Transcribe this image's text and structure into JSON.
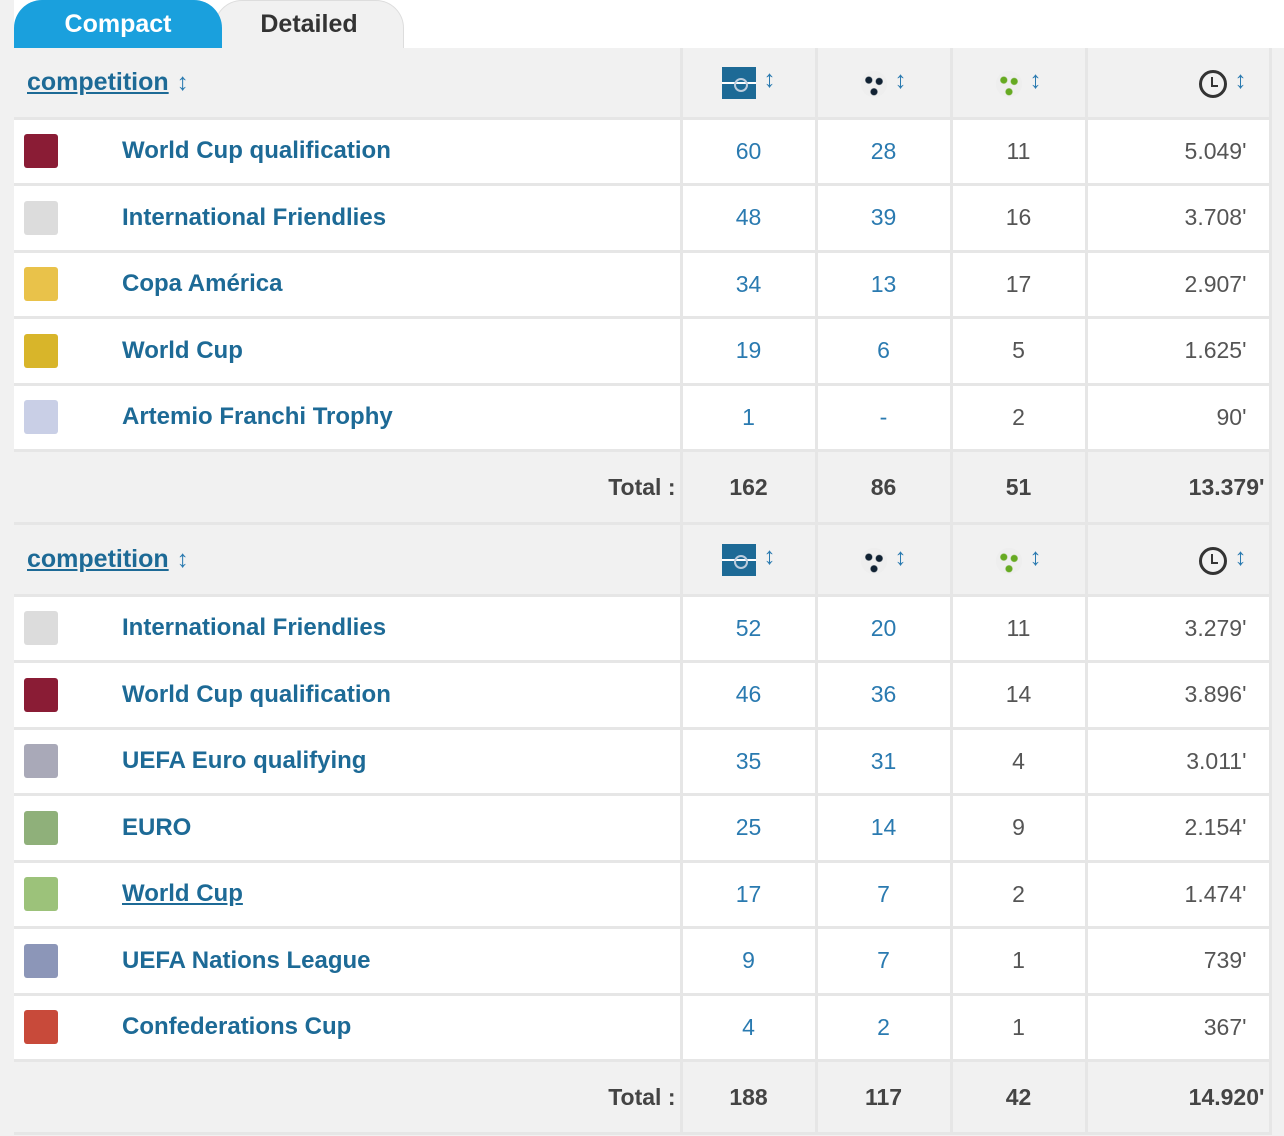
{
  "tabs": [
    {
      "label": "Compact",
      "active": true
    },
    {
      "label": "Detailed",
      "active": false
    }
  ],
  "header": {
    "competition": "competition",
    "sort_icon": "↕",
    "columns": [
      "appearances-icon",
      "goals-icon",
      "assists-icon",
      "minutes-icon"
    ]
  },
  "tables": [
    {
      "rows": [
        {
          "logo_color": "#8a1c35",
          "name": "World Cup qualification",
          "apps": "60",
          "goals": "28",
          "assists": "11",
          "minutes": "5.049'"
        },
        {
          "logo_color": "#dcdcdc",
          "name": "International Friendlies",
          "apps": "48",
          "goals": "39",
          "assists": "16",
          "minutes": "3.708'"
        },
        {
          "logo_color": "#e9c24a",
          "name": "Copa América",
          "apps": "34",
          "goals": "13",
          "assists": "17",
          "minutes": "2.907'"
        },
        {
          "logo_color": "#d8b52a",
          "name": "World Cup",
          "apps": "19",
          "goals": "6",
          "assists": "5",
          "minutes": "1.625'"
        },
        {
          "logo_color": "#c9cfe6",
          "name": "Artemio Franchi Trophy",
          "apps": "1",
          "goals": "-",
          "assists": "2",
          "minutes": "90'"
        }
      ],
      "total": {
        "label": "Total :",
        "apps": "162",
        "goals": "86",
        "assists": "51",
        "minutes": "13.379'"
      }
    },
    {
      "rows": [
        {
          "logo_color": "#dcdcdc",
          "name": "International Friendlies",
          "apps": "52",
          "goals": "20",
          "assists": "11",
          "minutes": "3.279'"
        },
        {
          "logo_color": "#8a1c35",
          "name": "World Cup qualification",
          "apps": "46",
          "goals": "36",
          "assists": "14",
          "minutes": "3.896'"
        },
        {
          "logo_color": "#a9a9b8",
          "name": "UEFA Euro qualifying",
          "apps": "35",
          "goals": "31",
          "assists": "4",
          "minutes": "3.011'"
        },
        {
          "logo_color": "#8fb07a",
          "name": "EURO",
          "apps": "25",
          "goals": "14",
          "assists": "9",
          "minutes": "2.154'"
        },
        {
          "logo_color": "#9cc27a",
          "name": "World Cup",
          "apps": "17",
          "goals": "7",
          "assists": "2",
          "minutes": "1.474'",
          "hover": true
        },
        {
          "logo_color": "#8c96b8",
          "name": "UEFA Nations League",
          "apps": "9",
          "goals": "7",
          "assists": "1",
          "minutes": "739'"
        },
        {
          "logo_color": "#c84a3a",
          "name": "Confederations Cup",
          "apps": "4",
          "goals": "2",
          "assists": "1",
          "minutes": "367'"
        }
      ],
      "total": {
        "label": "Total :",
        "apps": "188",
        "goals": "117",
        "assists": "42",
        "minutes": "14.920'"
      }
    }
  ]
}
